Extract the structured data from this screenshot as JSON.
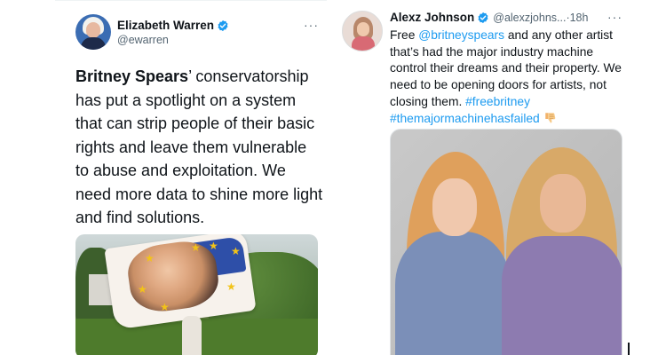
{
  "left_tweet": {
    "author_name": "Elizabeth Warren",
    "author_handle": "@ewarren",
    "more_label": "···",
    "text_bold": "Britney Spears",
    "text_rest": "’ conservatorship has put a spotlight on a system that can strip people of their basic rights and leave them vulnerable to abuse and exploitation. We need more data to shine more light and find solutions.",
    "avatar_icon": "warren-avatar",
    "media_icon": "britney-flag-photo"
  },
  "right_tweet": {
    "author_name": "Alexz Johnson",
    "author_handle": "@alexzjohns...",
    "separator": " · ",
    "timestamp": "18h",
    "more_label": "···",
    "text_part1": "Free ",
    "mention": "@britneyspears",
    "text_part2": " and any other artist that’s had the major industry machine control their dreams and their property. We need to be opening doors for artists, not closing them. ",
    "hashtag1": "#freebritney",
    "hashtag2": "#themajormachinehasfailed",
    "emoji_icon": "thumbs-down-icon",
    "avatar_icon": "alexz-avatar",
    "media_icon": "two-women-photo"
  },
  "colors": {
    "link": "#1d9bf0",
    "verified": "#1d9bf0",
    "secondary_text": "#536471",
    "primary_text": "#0f1419"
  }
}
